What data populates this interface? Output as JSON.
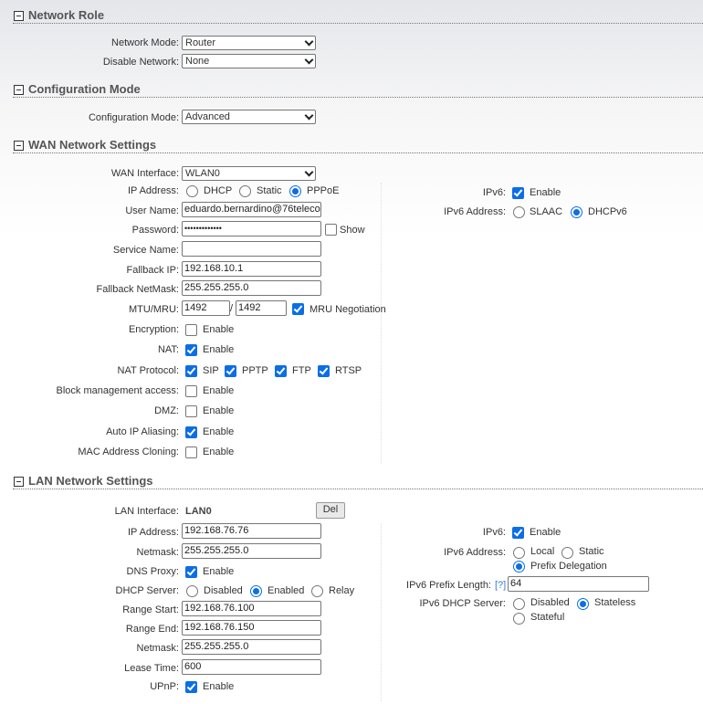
{
  "network_role": {
    "title": "Network Role",
    "network_mode_label": "Network Mode:",
    "network_mode": "Router",
    "disable_network_label": "Disable Network:",
    "disable_network": "None"
  },
  "configuration_mode": {
    "title": "Configuration Mode",
    "label": "Configuration Mode:",
    "value": "Advanced"
  },
  "wan": {
    "title": "WAN Network Settings",
    "interface_label": "WAN Interface:",
    "interface": "WLAN0",
    "ip_address_label": "IP Address:",
    "ip_options": [
      "DHCP",
      "Static",
      "PPPoE"
    ],
    "ip_selected": "PPPoE",
    "username_label": "User Name:",
    "username": "eduardo.bernardino@76teleco",
    "password_label": "Password:",
    "password": "•••••••••••••",
    "show_label": "Show",
    "show_checked": false,
    "service_name_label": "Service Name:",
    "service_name": "",
    "fallback_ip_label": "Fallback IP:",
    "fallback_ip": "192.168.10.1",
    "fallback_netmask_label": "Fallback NetMask:",
    "fallback_netmask": "255.255.255.0",
    "mtu_label": "MTU/MRU:",
    "mtu": "1492",
    "separator": "/",
    "mru": "1492",
    "mru_negotiation_label": "MRU Negotiation",
    "mru_negotiation": true,
    "encryption_label": "Encryption:",
    "encryption": false,
    "nat_label": "NAT:",
    "nat": true,
    "nat_protocol_label": "NAT Protocol:",
    "nat_protocols": [
      {
        "label": "SIP",
        "checked": true
      },
      {
        "label": "PPTP",
        "checked": true
      },
      {
        "label": "FTP",
        "checked": true
      },
      {
        "label": "RTSP",
        "checked": true
      }
    ],
    "block_mgmt_label": "Block management access:",
    "block_mgmt": false,
    "dmz_label": "DMZ:",
    "dmz": false,
    "auto_ip_label": "Auto IP Aliasing:",
    "auto_ip": true,
    "mac_clone_label": "MAC Address Cloning:",
    "mac_clone": false,
    "enable_label": "Enable",
    "ipv6_label": "IPv6:",
    "ipv6": true,
    "ipv6_address_label": "IPv6 Address:",
    "ipv6_options": [
      "SLAAC",
      "DHCPv6"
    ],
    "ipv6_selected": "DHCPv6"
  },
  "lan": {
    "title": "LAN Network Settings",
    "interface_label": "LAN Interface:",
    "interface": "LAN0",
    "del_label": "Del",
    "ip_label": "IP Address:",
    "ip": "192.168.76.76",
    "netmask_label": "Netmask:",
    "netmask": "255.255.255.0",
    "dns_proxy_label": "DNS Proxy:",
    "dns_proxy": true,
    "dhcp_server_label": "DHCP Server:",
    "dhcp_options": [
      "Disabled",
      "Enabled",
      "Relay"
    ],
    "dhcp_selected": "Enabled",
    "range_start_label": "Range Start:",
    "range_start": "192.168.76.100",
    "range_end_label": "Range End:",
    "range_end": "192.168.76.150",
    "dhcp_netmask_label": "Netmask:",
    "dhcp_netmask": "255.255.255.0",
    "lease_label": "Lease Time:",
    "lease": "600",
    "upnp_label": "UPnP:",
    "upnp": true,
    "enable_label": "Enable",
    "ipv6_label": "IPv6:",
    "ipv6": true,
    "ipv6_address_label": "IPv6 Address:",
    "ipv6_options": [
      "Local",
      "Static",
      "Prefix Delegation"
    ],
    "ipv6_selected": "Prefix Delegation",
    "prefix_length_label": "IPv6 Prefix Length:",
    "prefix_help": "[?]",
    "prefix_length": "64",
    "ipv6_dhcp_label": "IPv6 DHCP Server:",
    "ipv6_dhcp_options": [
      "Disabled",
      "Stateless",
      "Stateful"
    ],
    "ipv6_dhcp_selected": "Stateless"
  },
  "colors": {
    "accent": "#0b6ee6",
    "help_link": "#3a7bd5"
  }
}
